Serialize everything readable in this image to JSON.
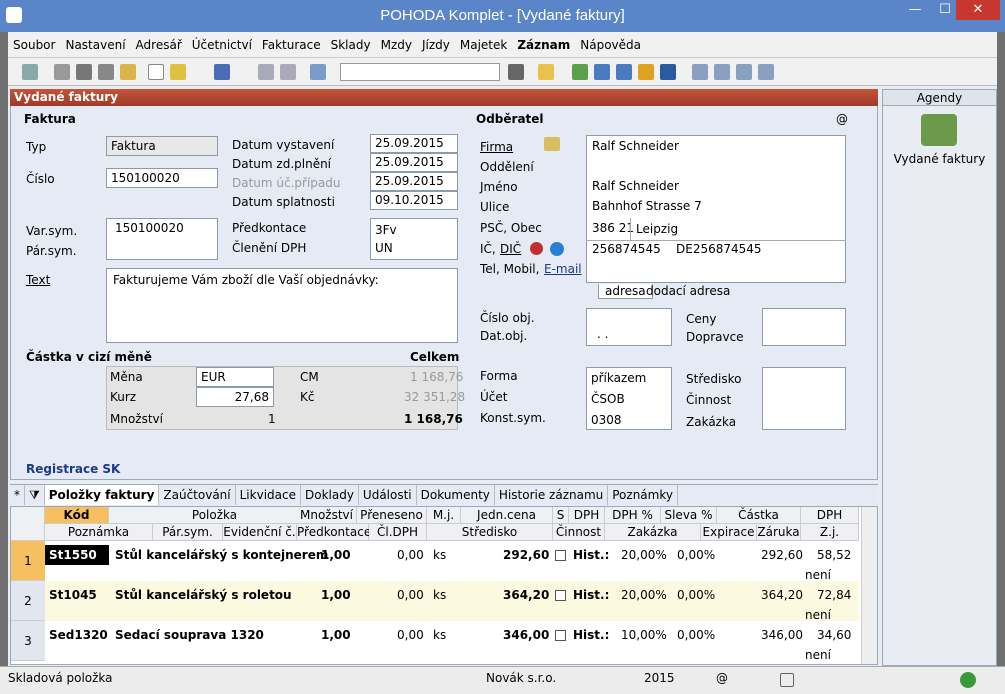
{
  "window": {
    "title": "POHODA Komplet - [Vydané faktury]",
    "minimize": "—",
    "maximize": "☐",
    "close": "✕"
  },
  "menu": [
    "Soubor",
    "Nastavení",
    "Adresář",
    "Účetnictví",
    "Fakturace",
    "Sklady",
    "Mzdy",
    "Jízdy",
    "Majetek",
    "Záznam",
    "Nápověda"
  ],
  "panel": {
    "title": "Vydané faktury",
    "faktura": {
      "heading": "Faktura",
      "typ_label": "Typ",
      "typ_value": "Faktura",
      "cislo_label": "Číslo",
      "cislo_value": "150100020",
      "varsym_label": "Var.sym.",
      "varsym_value": "150100020",
      "parsym_label": "Pár.sym.",
      "text_label": "Text",
      "text_value": "Fakturujeme Vám zboží dle Vaší objednávky:",
      "datum_vystaveni_label": "Datum vystavení",
      "datum_vystaveni": "25.09.2015",
      "datum_zdplneni_label": "Datum zd.plnění",
      "datum_zdplneni": "25.09.2015",
      "datum_ucpripadu_label": "Datum úč.případu",
      "datum_ucpripadu": "25.09.2015",
      "datum_splatnosti_label": "Datum splatnosti",
      "datum_splatnosti": "09.10.2015",
      "predkontace_label": "Předkontace",
      "predkontace_value": "3Fv",
      "cleneni_label": "Členění DPH",
      "cleneni_value": "UN"
    },
    "cizi_mena": {
      "heading": "Částka v cizí měně",
      "celkem_label": "Celkem",
      "mena_label": "Měna",
      "mena_value": "EUR",
      "kurz_label": "Kurz",
      "kurz_value": "27,68",
      "mnozstvi_label": "Množství",
      "mnozstvi_value": "1",
      "cm_label": "CM",
      "cm_value": "1 168,76",
      "kc_label": "Kč",
      "kc_value": "32 351,28",
      "total": "1 168,76"
    },
    "odberatel": {
      "heading": "Odběratel",
      "at": "@",
      "firma_label": "Firma",
      "firma_value": "Ralf Schneider",
      "oddeleni_label": "Oddělení",
      "jmeno_label": "Jméno",
      "jmeno_value": "Ralf Schneider",
      "ulice_label": "Ulice",
      "ulice_value": "Bahnhof Strasse 7",
      "psc_label": "PSČ, Obec",
      "psc_value": "386 21",
      "obec_value": "Leipzig",
      "ic_label": "IČ,",
      "dic_label": "DIČ",
      "ic_value": "256874545",
      "dic_value": "DE256874545",
      "tel_label": "Tel, Mobil,",
      "email_label": "E-mail",
      "tab_adresa": "adresa",
      "tab_dodaci": "dodací adresa"
    },
    "objednavka": {
      "cislo_obj_label": "Číslo obj.",
      "dat_obj_label": "Dat.obj.",
      "dat_obj_value": ". .",
      "ceny_label": "Ceny",
      "dopravce_label": "Dopravce",
      "forma_label": "Forma",
      "forma_value": "příkazem",
      "ucet_label": "Účet",
      "ucet_value": "ČSOB",
      "konst_label": "Konst.sym.",
      "konst_value": "0308",
      "stredisko_label": "Středisko",
      "cinnost_label": "Činnost",
      "zakazka_label": "Zakázka"
    },
    "registrace": "Registrace SK"
  },
  "agendy": {
    "title": "Agendy",
    "item": "Vydané faktury"
  },
  "tabs": [
    "Položky faktury",
    "Zaúčtování",
    "Likvidace",
    "Doklady",
    "Události",
    "Dokumenty",
    "Historie záznamu",
    "Poznámky"
  ],
  "tabs_star": "*",
  "grid": {
    "headers1": [
      "Kód",
      "Položka",
      "Množství",
      "Přeneseno",
      "M.j.",
      "Jedn.cena",
      "S",
      "DPH",
      "DPH %",
      "Sleva %",
      "Částka",
      "DPH"
    ],
    "headers2": [
      "Poznámka",
      "Pár.sym.",
      "Evidenční č.",
      "Předkontace",
      "Čl.DPH",
      "Středisko",
      "Činnost",
      "Zakázka",
      "Expirace",
      "Záruka",
      "Z.j."
    ],
    "rows": [
      {
        "n": "1",
        "kod": "St1550",
        "polozka": "Stůl kancelářský s kontejnerem",
        "mnozstvi": "1,00",
        "preneseno": "0,00",
        "mj": "ks",
        "cena": "292,60",
        "dph": "Hist.:",
        "dphp": "20,00%",
        "sleva": "0,00%",
        "castka": "292,60",
        "dphv": "58,52",
        "zj": "není"
      },
      {
        "n": "2",
        "kod": "St1045",
        "polozka": "Stůl kancelářský s roletou",
        "mnozstvi": "1,00",
        "preneseno": "0,00",
        "mj": "ks",
        "cena": "364,20",
        "dph": "Hist.:",
        "dphp": "20,00%",
        "sleva": "0,00%",
        "castka": "364,20",
        "dphv": "72,84",
        "zj": "není"
      },
      {
        "n": "3",
        "kod": "Sed1320",
        "polozka": "Sedací souprava 1320",
        "mnozstvi": "1,00",
        "preneseno": "0,00",
        "mj": "ks",
        "cena": "346,00",
        "dph": "Hist.:",
        "dphp": "10,00%",
        "sleva": "0,00%",
        "castka": "346,00",
        "dphv": "34,60",
        "zj": "není"
      }
    ]
  },
  "status": {
    "left": "Skladová položka",
    "company": "Novák s.r.o.",
    "year": "2015",
    "at": "@"
  }
}
